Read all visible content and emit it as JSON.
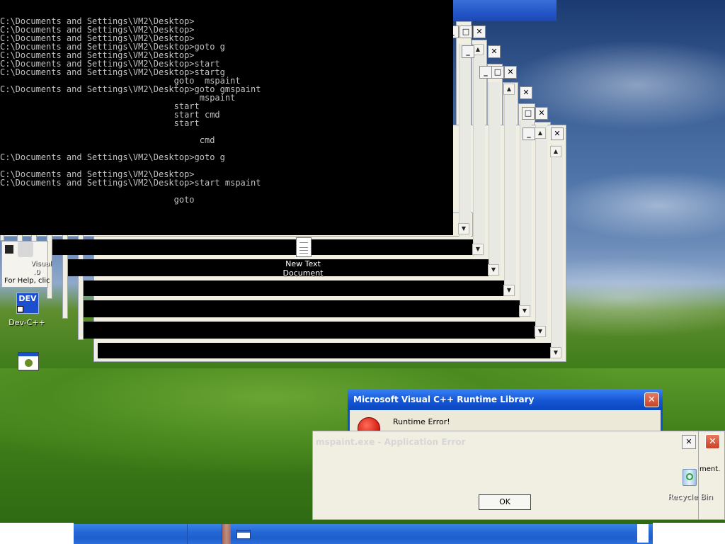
{
  "console": {
    "lines": [
      "",
      "",
      "C:\\Documents and Settings\\VM2\\Desktop>",
      "C:\\Documents and Settings\\VM2\\Desktop>",
      "C:\\Documents and Settings\\VM2\\Desktop>",
      "C:\\Documents and Settings\\VM2\\Desktop>goto g",
      "C:\\Documents and Settings\\VM2\\Desktop>",
      "C:\\Documents and Settings\\VM2\\Desktop>start",
      "C:\\Documents and Settings\\VM2\\Desktop>startg",
      "                                  goto  mspaint",
      "C:\\Documents and Settings\\VM2\\Desktop>goto gmspaint",
      "                                       mspaint",
      "                                  start",
      "                                  start cmd",
      "                                  start",
      "",
      "                                       cmd",
      "",
      "C:\\Documents and Settings\\VM2\\Desktop>goto g",
      "",
      "C:\\Documents and Settings\\VM2\\Desktop>",
      "C:\\Documents and Settings\\VM2\\Desktop>start mspaint",
      "",
      "                                  goto"
    ]
  },
  "window_buttons": {
    "minimize": "_",
    "maximize": "□",
    "close": "✕"
  },
  "scroll": {
    "up": "▲",
    "down": "▼"
  },
  "paint": {
    "status": "For Help, clic",
    "visual_label_a": "Visual",
    "visual_label_b": ".0"
  },
  "desktop_icons": {
    "new_text_doc_line1": "New Text",
    "new_text_doc_line2": "Document",
    "dev_cpp": "Dev-C++",
    "dev_badge": "DEV",
    "recycle_bin": "Recycle Bin"
  },
  "vc_dialog": {
    "title": "Microsoft Visual C++ Runtime Library",
    "message": "Runtime Error!",
    "close": "✕"
  },
  "app_error": {
    "title": "mspaint.exe - Application Error",
    "ok": "OK",
    "close": "✕",
    "behind_text": "ment."
  }
}
